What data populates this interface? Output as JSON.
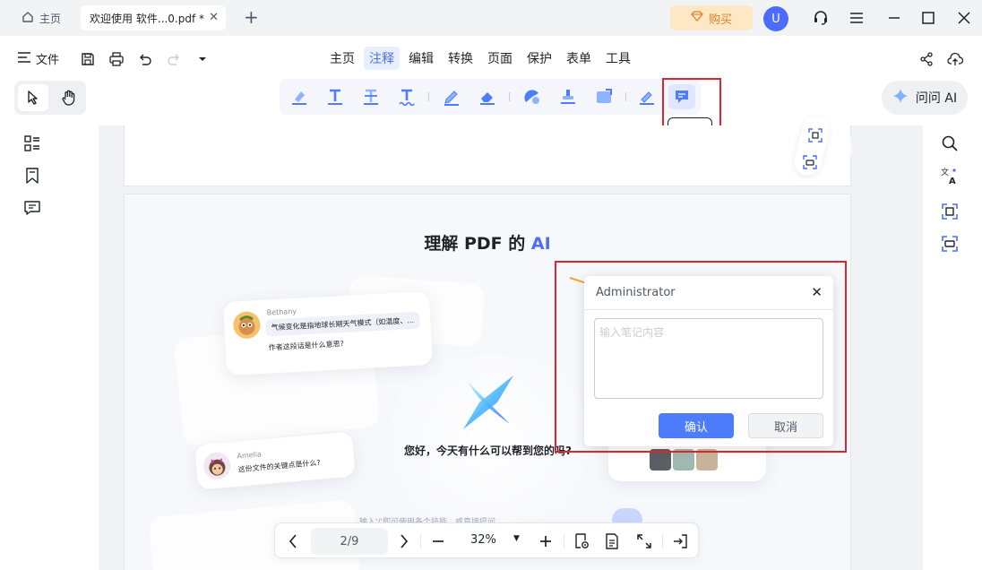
{
  "titlebar": {
    "home_tab_label": "主页",
    "doc_tab_label": "欢迎使用 软件...0.pdf *",
    "buy_label": "购买",
    "avatar_initial": "U"
  },
  "menubar": {
    "file_label": "文件",
    "items": [
      "主页",
      "注释",
      "编辑",
      "转换",
      "页面",
      "保护",
      "表单",
      "工具"
    ],
    "active_item": "注释"
  },
  "toolbar": {
    "sticky_note_tooltip": "便签",
    "ask_ai_label": "问问 AI"
  },
  "document": {
    "page_title_prefix": "理解 PDF 的 ",
    "page_title_accent": "AI",
    "chat1_name": "Bethany",
    "chat1_bubble": "气候变化是指地球长期天气模式（如温度、...",
    "chat1_question": "作者这段话是什么意思?",
    "chat2_name": "Amelia",
    "chat2_question": "这份文件的关键点是什么?",
    "greeting": "您好，今天有什么可以帮到您的吗?",
    "input_hint": "输入'/'即可使用各个技能，或直接提问"
  },
  "note_dialog": {
    "author": "Administrator",
    "placeholder": "输入笔记内容",
    "confirm_label": "确认",
    "cancel_label": "取消"
  },
  "bottom_nav": {
    "page_indicator": "2/9",
    "zoom": "32%"
  },
  "colors": {
    "accent": "#4d6bfe",
    "highlight_box": "#d9262f",
    "buy_bg": "#fde7c4",
    "buy_text": "#d9822b"
  }
}
